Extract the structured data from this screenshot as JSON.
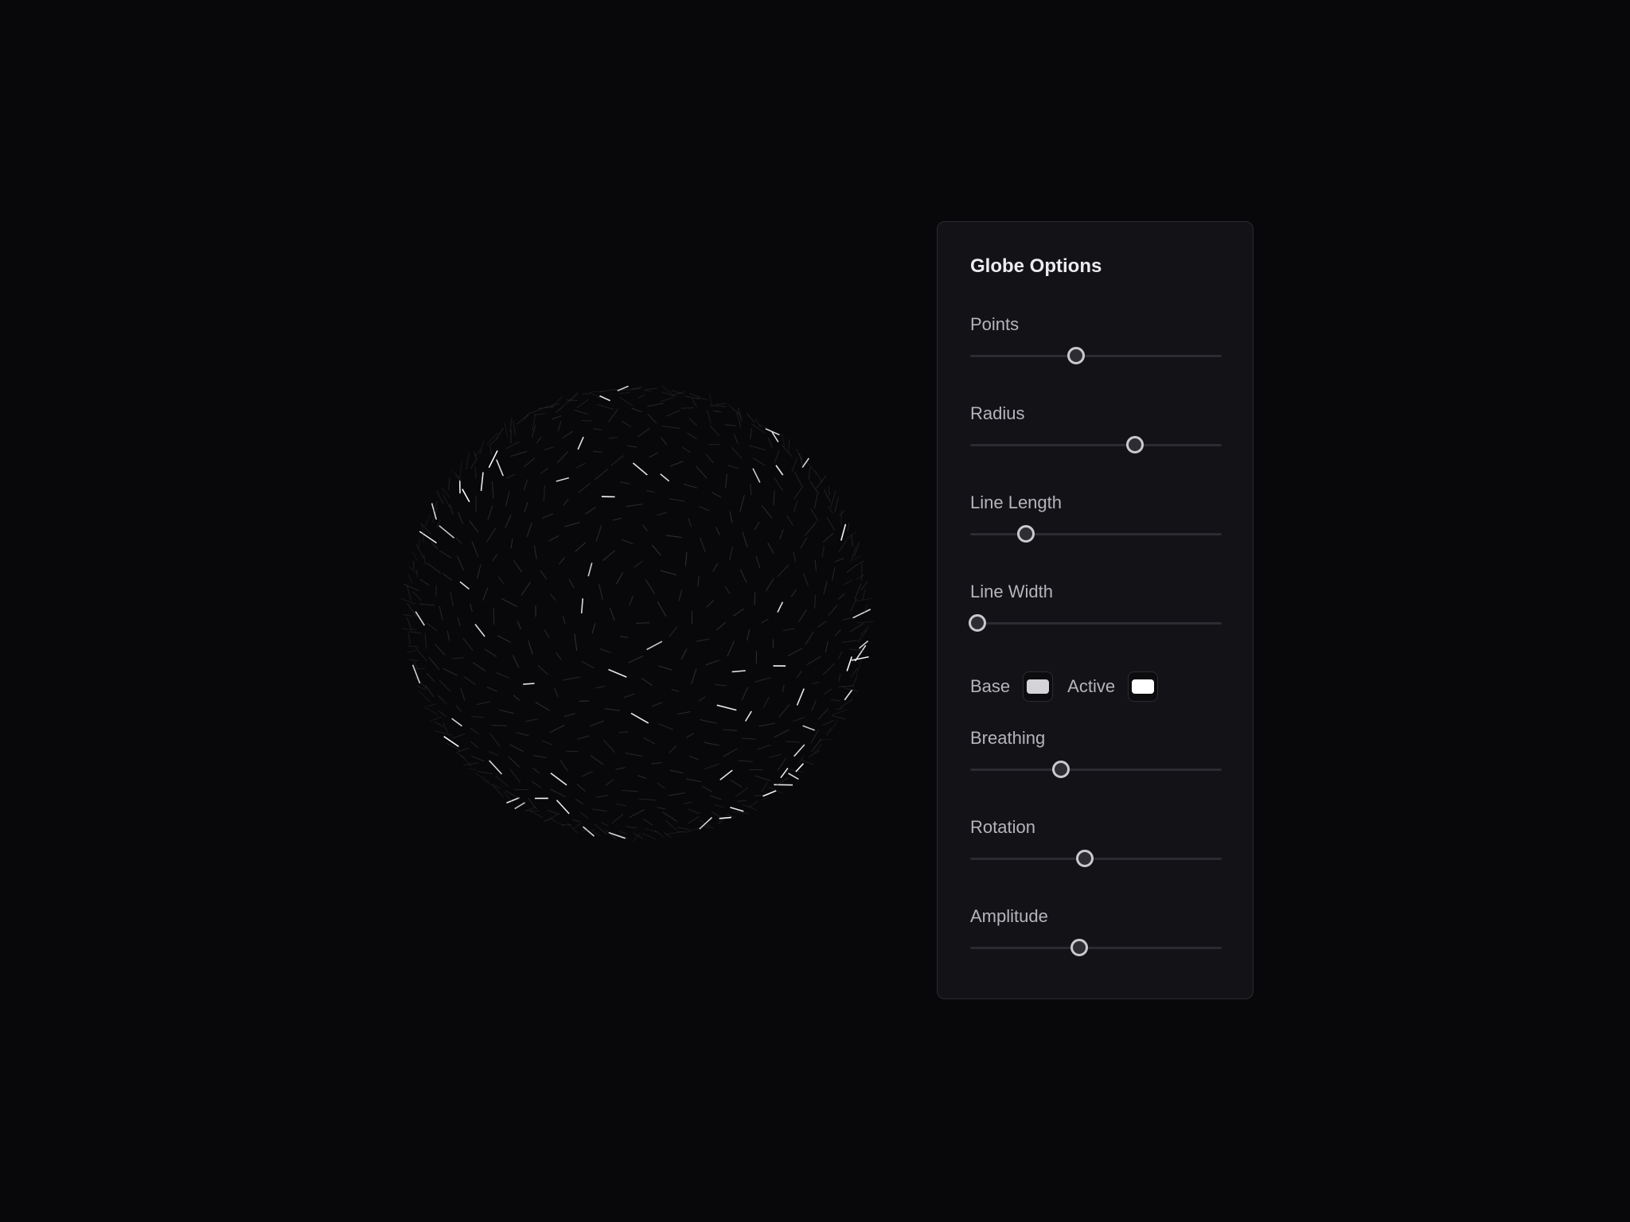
{
  "panel": {
    "title": "Globe Options",
    "sliders": [
      {
        "label": "Points",
        "value": 0.42
      },
      {
        "label": "Radius",
        "value": 0.655
      },
      {
        "label": "Line Length",
        "value": 0.22
      },
      {
        "label": "Line Width",
        "value": 0.03
      },
      {
        "label": "Breathing",
        "value": 0.36
      },
      {
        "label": "Rotation",
        "value": 0.455
      },
      {
        "label": "Amplitude",
        "value": 0.435
      }
    ],
    "colors": {
      "base_label": "Base",
      "base_color": "#d4d4d8",
      "active_label": "Active",
      "active_color": "#ffffff"
    }
  },
  "colors": {
    "background": "#08080a",
    "panel": "#131317",
    "accent_line": "#ffffff"
  }
}
